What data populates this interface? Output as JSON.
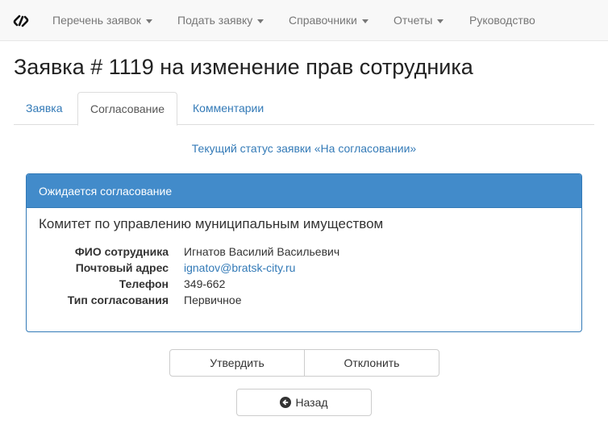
{
  "navbar": {
    "brand_icon": "logo-icon",
    "items": [
      {
        "label": "Перечень заявок",
        "dropdown": true
      },
      {
        "label": "Подать заявку",
        "dropdown": true
      },
      {
        "label": "Справочники",
        "dropdown": true
      },
      {
        "label": "Отчеты",
        "dropdown": true
      },
      {
        "label": "Руководство",
        "dropdown": false
      }
    ]
  },
  "page": {
    "title": "Заявка # 1119 на изменение прав сотрудника"
  },
  "tabs": [
    {
      "label": "Заявка",
      "active": false
    },
    {
      "label": "Согласование",
      "active": true
    },
    {
      "label": "Комментарии",
      "active": false
    }
  ],
  "status_text": "Текущий статус заявки «На согласовании»",
  "panel": {
    "heading": "Ожидается согласование",
    "organization": "Комитет по управлению муниципальным имуществом",
    "fields": [
      {
        "label": "ФИО сотрудника",
        "value": "Игнатов Василий Васильевич",
        "link": false
      },
      {
        "label": "Почтовый адрес",
        "value": "ignatov@bratsk-city.ru",
        "link": true
      },
      {
        "label": "Телефон",
        "value": "349-662",
        "link": false
      },
      {
        "label": "Тип согласования",
        "value": "Первичное",
        "link": false
      }
    ]
  },
  "buttons": {
    "approve": "Утвердить",
    "reject": "Отклонить",
    "back": "Назад",
    "back_icon": "circle-arrow-left-icon"
  },
  "colors": {
    "link": "#337ab7",
    "panel_heading": "#428bca",
    "navbar_bg": "#f8f8f8"
  }
}
